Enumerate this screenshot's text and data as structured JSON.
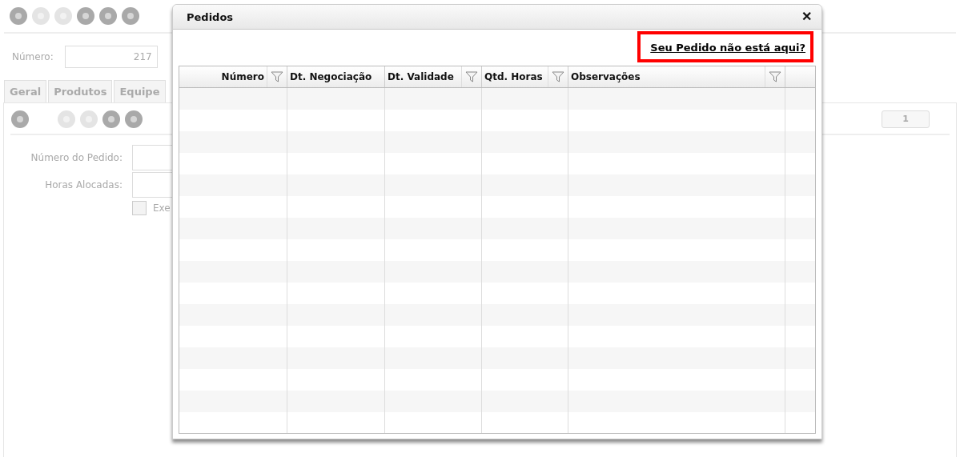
{
  "background": {
    "toolbar_buttons": [
      {
        "disabled": false
      },
      {
        "disabled": true
      },
      {
        "disabled": true
      },
      {
        "disabled": false
      },
      {
        "disabled": false
      },
      {
        "disabled": false
      }
    ],
    "number_field": {
      "label": "Número:",
      "value": "217"
    },
    "tabs": [
      {
        "label": "Geral"
      },
      {
        "label": "Produtos"
      },
      {
        "label": "Equipe"
      }
    ],
    "sub_toolbar_buttons": [
      {
        "disabled": false
      },
      {
        "disabled": true
      },
      {
        "disabled": true
      },
      {
        "disabled": false
      },
      {
        "disabled": false
      }
    ],
    "page_indicator": "1",
    "fields": [
      {
        "label": "Número do Pedido:"
      },
      {
        "label": "Horas Alocadas:"
      }
    ],
    "checkbox": {
      "label": "Exe",
      "checked": false
    }
  },
  "dialog": {
    "title": "Pedidos",
    "close": "✕",
    "link": "Seu Pedido não está aqui?",
    "columns": [
      {
        "label": "Número",
        "filter": true
      },
      {
        "label": "Dt. Negociação",
        "filter": false
      },
      {
        "label": "Dt. Validade",
        "filter": true
      },
      {
        "label": "Qtd. Horas",
        "filter": true
      },
      {
        "label": "Observações",
        "filter": true
      }
    ]
  }
}
